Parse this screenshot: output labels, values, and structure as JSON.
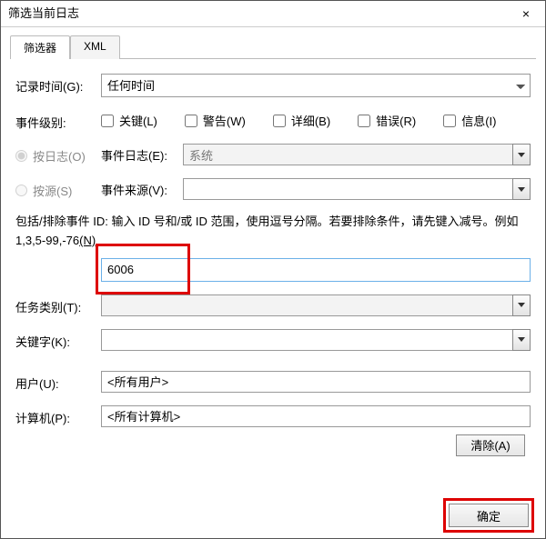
{
  "window": {
    "title": "筛选当前日志",
    "close": "×"
  },
  "tabs": {
    "filter": "筛选器",
    "xml": "XML"
  },
  "form": {
    "logged_label": "记录时间(G):",
    "logged_value": "任何时间",
    "level_label": "事件级别:",
    "checks": {
      "critical": "关键(L)",
      "warning": "警告(W)",
      "verbose": "详细(B)",
      "error": "错误(R)",
      "info": "信息(I)"
    },
    "bylog_label": "按日志(O)",
    "eventlog_label": "事件日志(E):",
    "eventlog_value": "系统",
    "bysource_label": "按源(S)",
    "eventsrc_label": "事件来源(V):",
    "include_desc_1": "包括/排除事件 ID: 输入 ID 号和/或 ID 范围，使用逗号分隔。若要排除条件，请先键入减号。例如 1,3,5-99,-76",
    "include_desc_u": "(N)",
    "event_id_value": "6006",
    "task_label": "任务类别(T):",
    "keyword_label": "关键字(K):",
    "user_label": "用户(U):",
    "user_value": "<所有用户>",
    "computer_label": "计算机(P):",
    "computer_value": "<所有计算机>",
    "clear_btn": "清除(A)"
  },
  "footer": {
    "ok": "确定"
  }
}
